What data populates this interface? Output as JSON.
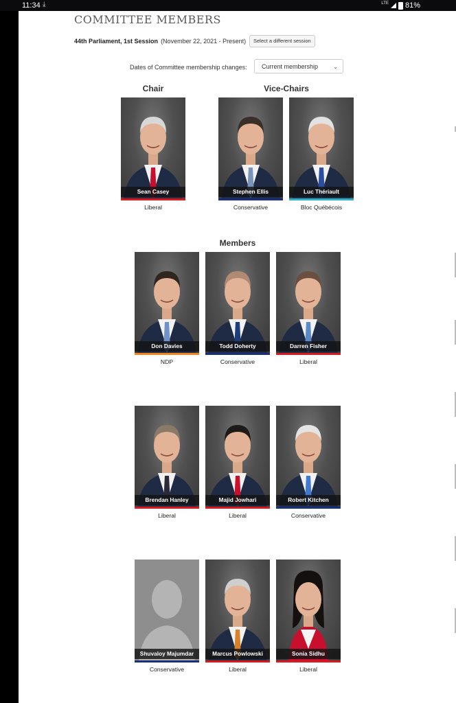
{
  "status_bar": {
    "time": "11:34",
    "download_icon": "download-icon",
    "network": "LTE",
    "battery": "81%"
  },
  "heading": "COMMITTEE MEMBERS",
  "session": {
    "title": "44th Parliament, 1st Session",
    "dates": "(November 22, 2021 - Present)",
    "button_label": "Select a different session"
  },
  "membership": {
    "label": "Dates of Committee membership changes:",
    "selected": "Current membership"
  },
  "sections": {
    "chair": "Chair",
    "vice_chairs": "Vice-Chairs",
    "members": "Members"
  },
  "party_colors": {
    "Liberal": "#d71920",
    "Conservative": "#1a2f7a",
    "Bloc Québécois": "#33b2cc",
    "NDP": "#f58220"
  },
  "chair": [
    {
      "name": "Sean Casey",
      "party": "Liberal",
      "party_color": "#d71920",
      "tie": "#c8102e",
      "hair": "#d8d8d8"
    }
  ],
  "vice_chairs": [
    {
      "name": "Stephen Ellis",
      "party": "Conservative",
      "party_color": "#1a2f7a",
      "tie": "#7a93b8",
      "hair": "#3a2f28"
    },
    {
      "name": "Luc Thériault",
      "party": "Bloc Québécois",
      "party_color": "#33b2cc",
      "tie": "#2b4f9e",
      "hair": "#e2e2e2"
    }
  ],
  "members": [
    {
      "name": "Don Davies",
      "party": "NDP",
      "party_color": "#f58220",
      "tie": "#6f93c8",
      "hair": "#2f2620"
    },
    {
      "name": "Todd Doherty",
      "party": "Conservative",
      "party_color": "#1a2f7a",
      "tie": "#1c3d7a",
      "hair": "#b08a73"
    },
    {
      "name": "Darren Fisher",
      "party": "Liberal",
      "party_color": "#d71920",
      "tie": "#5a8ac8",
      "hair": "#6a5040"
    },
    {
      "name": "Brendan Hanley",
      "party": "Liberal",
      "party_color": "#d71920",
      "tie": "#2a2a3a",
      "hair": "#8a7a68"
    },
    {
      "name": "Majid Jowhari",
      "party": "Liberal",
      "party_color": "#d71920",
      "tie": "#c8102e",
      "hair": "#1e1a18"
    },
    {
      "name": "Robert Kitchen",
      "party": "Conservative",
      "party_color": "#1a2f7a",
      "tie": "#3f7ad0",
      "hair": "#e4e4e4"
    },
    {
      "name": "Shuvaloy Majumdar",
      "party": "Conservative",
      "party_color": "#1a2f7a",
      "tie": "",
      "hair": ""
    },
    {
      "name": "Marcus Powlowski",
      "party": "Liberal",
      "party_color": "#d71920",
      "tie": "#d8802a",
      "hair": "#cfcfcf"
    },
    {
      "name": "Sonia Sidhu",
      "party": "Liberal",
      "party_color": "#d71920",
      "tie": "",
      "hair": "#141010"
    }
  ]
}
